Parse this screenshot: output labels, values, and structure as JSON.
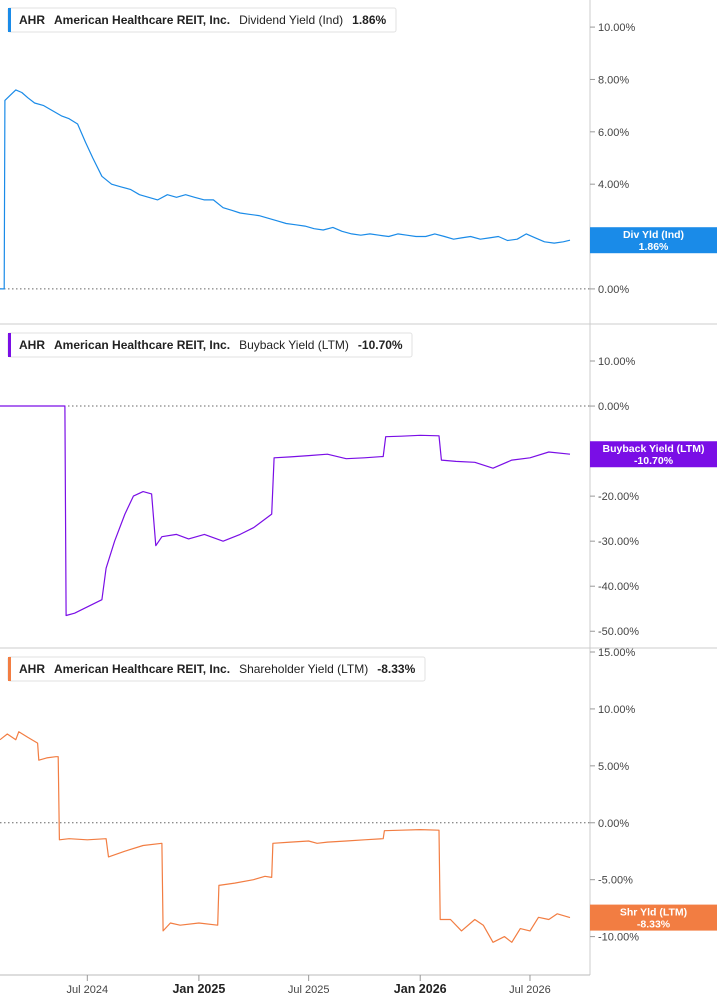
{
  "colors": {
    "dividend": "#1a8be8",
    "buyback": "#7a0ee6",
    "shareholder": "#f27d42",
    "grid_zero": "#666666",
    "divider": "#cccccc"
  },
  "x_ticks": [
    {
      "label": "Jul 2024",
      "date": "2024-07-01",
      "bold": false
    },
    {
      "label": "Jan 2025",
      "date": "2025-01-01",
      "bold": true
    },
    {
      "label": "Jul 2025",
      "date": "2025-07-01",
      "bold": false
    },
    {
      "label": "Jan 2026",
      "date": "2026-01-01",
      "bold": true
    },
    {
      "label": "Jul 2026",
      "date": "2026-07-01",
      "bold": false
    }
  ],
  "chart_data": [
    {
      "type": "line",
      "legend": {
        "ticker": "AHR",
        "company": "American Healthcare REIT, Inc.",
        "metric": "Dividend Yield (Ind)",
        "value": "1.86%"
      },
      "badge": {
        "label": "Div Yld (Ind)",
        "value": "1.86%"
      },
      "y_ticks": [
        "10.00%",
        "8.00%",
        "6.00%",
        "4.00%",
        "2.00%",
        "0.00%"
      ],
      "y_tick_values": [
        10,
        8,
        6,
        4,
        2,
        0
      ],
      "ylim": [
        -0.5,
        10.5
      ],
      "zero_line": true,
      "series": [
        {
          "x": [
            "2024-02-08",
            "2024-02-15",
            "2024-02-16",
            "2024-02-25",
            "2024-03-05",
            "2024-03-15",
            "2024-03-25",
            "2024-04-05",
            "2024-04-20",
            "2024-05-05",
            "2024-05-20",
            "2024-06-01",
            "2024-06-15",
            "2024-06-28",
            "2024-07-10",
            "2024-07-25",
            "2024-08-10",
            "2024-08-25",
            "2024-09-10",
            "2024-09-25",
            "2024-10-10",
            "2024-10-25",
            "2024-11-10",
            "2024-11-25",
            "2024-12-10",
            "2024-12-25",
            "2025-01-10",
            "2025-01-25",
            "2025-02-10",
            "2025-02-25",
            "2025-03-10",
            "2025-03-25",
            "2025-04-10",
            "2025-04-25",
            "2025-05-10",
            "2025-05-25",
            "2025-06-10",
            "2025-06-25",
            "2025-07-10",
            "2025-07-25",
            "2025-08-10",
            "2025-08-25",
            "2025-09-10",
            "2025-09-25",
            "2025-10-10",
            "2025-10-25",
            "2025-11-10",
            "2025-11-25",
            "2025-12-10",
            "2025-12-25",
            "2026-01-10",
            "2026-01-25",
            "2026-02-10",
            "2026-02-25",
            "2026-03-10",
            "2026-03-25",
            "2026-04-10",
            "2026-04-25",
            "2026-05-10",
            "2026-05-25",
            "2026-06-10",
            "2026-06-25",
            "2026-07-10",
            "2026-07-25",
            "2026-08-10",
            "2026-08-25",
            "2026-09-05"
          ],
          "y": [
            0.0,
            0.0,
            7.2,
            7.4,
            7.6,
            7.5,
            7.3,
            7.1,
            7.0,
            6.8,
            6.6,
            6.5,
            6.3,
            5.6,
            5.0,
            4.3,
            4.0,
            3.9,
            3.8,
            3.6,
            3.5,
            3.4,
            3.6,
            3.5,
            3.6,
            3.5,
            3.4,
            3.4,
            3.1,
            3.0,
            2.9,
            2.85,
            2.8,
            2.7,
            2.6,
            2.5,
            2.45,
            2.4,
            2.3,
            2.25,
            2.35,
            2.2,
            2.1,
            2.05,
            2.1,
            2.05,
            2.0,
            2.1,
            2.05,
            2.0,
            2.0,
            2.1,
            2.0,
            1.9,
            1.95,
            2.0,
            1.9,
            1.95,
            2.0,
            1.85,
            1.9,
            2.1,
            1.95,
            1.8,
            1.75,
            1.8,
            1.86
          ]
        }
      ]
    },
    {
      "type": "line",
      "legend": {
        "ticker": "AHR",
        "company": "American Healthcare REIT, Inc.",
        "metric": "Buyback Yield (LTM)",
        "value": "-10.70%"
      },
      "badge": {
        "label": "Buyback Yield (LTM)",
        "value": "-10.70%"
      },
      "y_ticks": [
        "10.00%",
        "0.00%",
        "-20.00%",
        "-30.00%",
        "-40.00%",
        "-50.00%"
      ],
      "y_tick_values": [
        10,
        0,
        -20,
        -30,
        -40,
        -50
      ],
      "ylim": [
        -51.5,
        12
      ],
      "zero_line": true,
      "series": [
        {
          "x": [
            "2024-02-08",
            "2024-05-25",
            "2024-05-27",
            "2024-06-10",
            "2024-06-25",
            "2024-07-10",
            "2024-07-25",
            "2024-08-01",
            "2024-08-15",
            "2024-09-01",
            "2024-09-15",
            "2024-10-01",
            "2024-10-15",
            "2024-10-22",
            "2024-11-01",
            "2024-11-25",
            "2024-12-15",
            "2025-01-10",
            "2025-02-10",
            "2025-03-10",
            "2025-04-01",
            "2025-05-01",
            "2025-05-05",
            "2025-06-01",
            "2025-07-01",
            "2025-08-01",
            "2025-09-01",
            "2025-10-01",
            "2025-11-01",
            "2025-11-05",
            "2025-12-01",
            "2026-01-01",
            "2026-02-01",
            "2026-02-05",
            "2026-03-01",
            "2026-04-01",
            "2026-05-01",
            "2026-06-01",
            "2026-07-01",
            "2026-08-01",
            "2026-09-05"
          ],
          "y": [
            0.0,
            0.0,
            -46.5,
            -46.0,
            -45.0,
            -44.0,
            -43.0,
            -36.0,
            -30.0,
            -24.0,
            -20.0,
            -19.0,
            -19.5,
            -31.0,
            -29.0,
            -28.5,
            -29.5,
            -28.5,
            -30.0,
            -28.5,
            -27.0,
            -24.0,
            -11.5,
            -11.3,
            -11.0,
            -10.7,
            -11.7,
            -11.5,
            -11.2,
            -6.8,
            -6.7,
            -6.5,
            -6.6,
            -12.0,
            -12.3,
            -12.5,
            -13.8,
            -12.0,
            -11.5,
            -10.2,
            -10.7
          ]
        }
      ]
    },
    {
      "type": "line",
      "legend": {
        "ticker": "AHR",
        "company": "American Healthcare REIT, Inc.",
        "metric": "Shareholder Yield (LTM)",
        "value": "-8.33%"
      },
      "badge": {
        "label": "Shr Yld (LTM)",
        "value": "-8.33%"
      },
      "y_ticks": [
        "15.00%",
        "10.00%",
        "5.00%",
        "0.00%",
        "-5.00%",
        "-10.00%"
      ],
      "y_tick_values": [
        15,
        10,
        5,
        0,
        -5,
        -10
      ],
      "ylim": [
        -11,
        15
      ],
      "zero_line": true,
      "series": [
        {
          "x": [
            "2024-02-08",
            "2024-02-20",
            "2024-03-05",
            "2024-03-10",
            "2024-03-25",
            "2024-04-10",
            "2024-04-12",
            "2024-04-25",
            "2024-05-10",
            "2024-05-14",
            "2024-05-16",
            "2024-06-01",
            "2024-07-01",
            "2024-08-01",
            "2024-08-05",
            "2024-09-01",
            "2024-10-01",
            "2024-11-01",
            "2024-11-03",
            "2024-11-15",
            "2024-12-01",
            "2025-01-01",
            "2025-02-01",
            "2025-02-03",
            "2025-03-01",
            "2025-04-01",
            "2025-04-20",
            "2025-05-01",
            "2025-05-03",
            "2025-06-01",
            "2025-07-01",
            "2025-07-15",
            "2025-08-01",
            "2025-09-01",
            "2025-10-01",
            "2025-11-01",
            "2025-11-03",
            "2025-12-01",
            "2026-01-01",
            "2026-02-01",
            "2026-02-03",
            "2026-02-20",
            "2026-03-10",
            "2026-04-01",
            "2026-04-15",
            "2026-05-01",
            "2026-05-20",
            "2026-06-01",
            "2026-06-15",
            "2026-07-01",
            "2026-07-15",
            "2026-08-01",
            "2026-08-15",
            "2026-09-05"
          ],
          "y": [
            7.3,
            7.8,
            7.3,
            8.0,
            7.5,
            7.0,
            5.5,
            5.7,
            5.8,
            5.8,
            -1.5,
            -1.4,
            -1.5,
            -1.4,
            -3.0,
            -2.5,
            -2.0,
            -1.8,
            -9.5,
            -8.8,
            -9.0,
            -8.8,
            -9.0,
            -5.5,
            -5.3,
            -5.0,
            -4.7,
            -4.8,
            -1.8,
            -1.7,
            -1.6,
            -1.8,
            -1.7,
            -1.6,
            -1.5,
            -1.4,
            -0.7,
            -0.65,
            -0.6,
            -0.65,
            -8.5,
            -8.5,
            -9.5,
            -8.5,
            -9.0,
            -10.5,
            -10.0,
            -10.5,
            -9.3,
            -9.5,
            -8.3,
            -8.5,
            -8.0,
            -8.33
          ]
        }
      ]
    }
  ]
}
